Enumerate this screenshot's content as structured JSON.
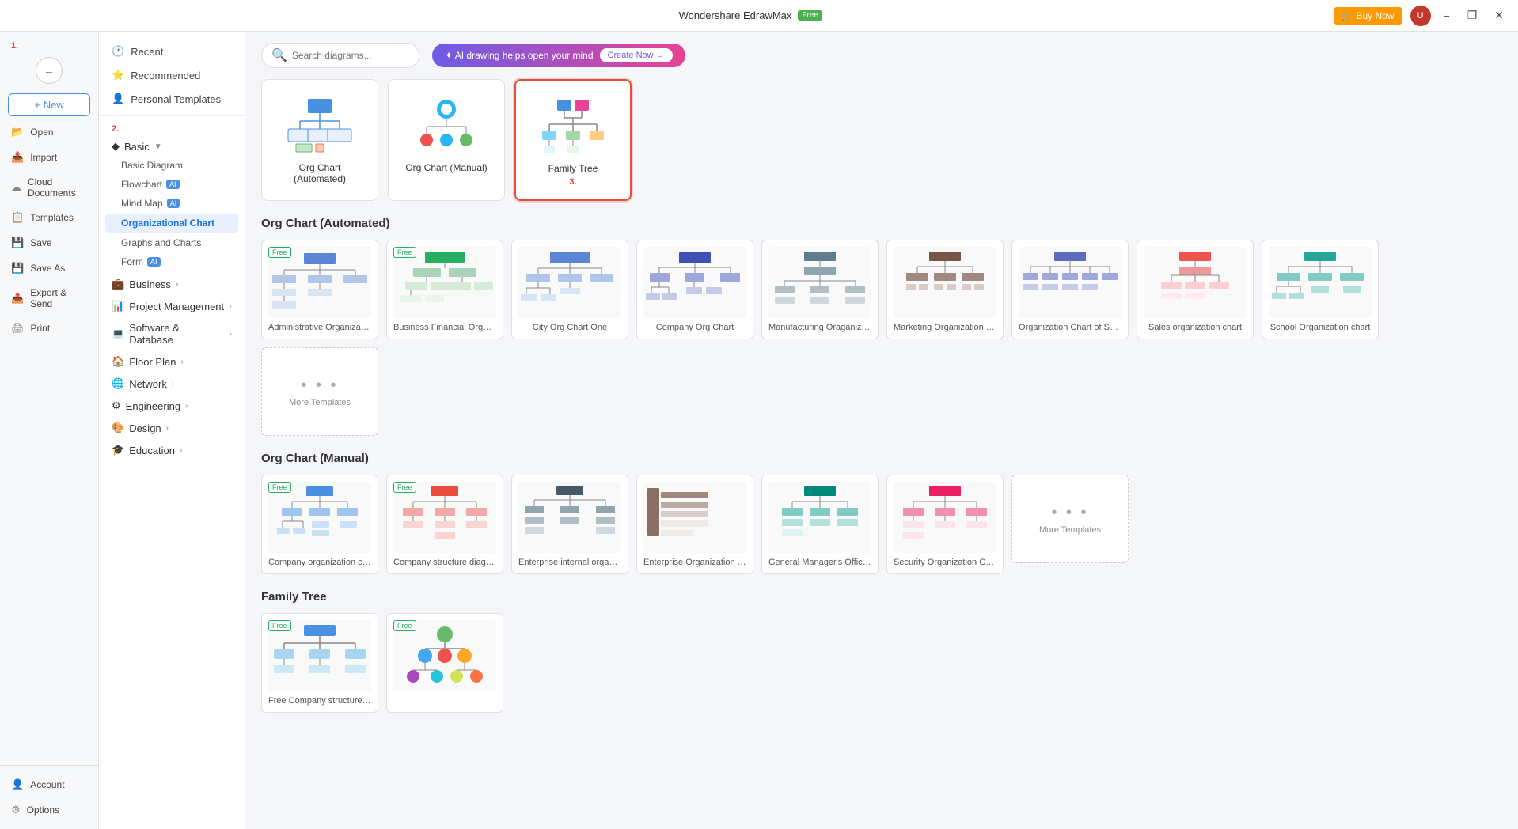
{
  "app": {
    "title": "Wondershare EdrawMax",
    "badge": "Free",
    "buy_now": "Buy Now"
  },
  "titlebar": {
    "win_minimize": "−",
    "win_restore": "❐",
    "win_close": "✕"
  },
  "sidebar": {
    "step1_label": "1.",
    "back_tooltip": "Back",
    "new_label": "New",
    "items": [
      {
        "id": "open",
        "icon": "📂",
        "label": "Open"
      },
      {
        "id": "import",
        "icon": "📥",
        "label": "Import"
      },
      {
        "id": "cloud",
        "icon": "☁",
        "label": "Cloud Documents"
      },
      {
        "id": "templates",
        "icon": "📋",
        "label": "Templates"
      },
      {
        "id": "save",
        "icon": "💾",
        "label": "Save"
      },
      {
        "id": "save-as",
        "icon": "💾",
        "label": "Save As"
      },
      {
        "id": "export",
        "icon": "📤",
        "label": "Export & Send"
      },
      {
        "id": "print",
        "icon": "🖨",
        "label": "Print"
      }
    ],
    "bottom_items": [
      {
        "id": "account",
        "icon": "👤",
        "label": "Account"
      },
      {
        "id": "options",
        "icon": "⚙",
        "label": "Options"
      }
    ]
  },
  "nav": {
    "step2_label": "2.",
    "recent_label": "Recent",
    "recommended_label": "Recommended",
    "personal_label": "Personal Templates",
    "sections": [
      {
        "id": "basic",
        "label": "Basic",
        "expanded": true,
        "subs": [
          {
            "id": "basic-diagram",
            "label": "Basic Diagram",
            "active": false
          },
          {
            "id": "flowchart",
            "label": "Flowchart",
            "ai": true,
            "active": false
          },
          {
            "id": "mind-map",
            "label": "Mind Map",
            "ai": true,
            "active": false
          },
          {
            "id": "org-chart",
            "label": "Organizational Chart",
            "active": true
          }
        ]
      },
      {
        "id": "graphs",
        "label": "Graphs and Charts",
        "subs": []
      },
      {
        "id": "form",
        "label": "Form",
        "ai": true,
        "subs": []
      },
      {
        "id": "business",
        "label": "Business",
        "subs": []
      },
      {
        "id": "project",
        "label": "Project Management",
        "subs": []
      },
      {
        "id": "software",
        "label": "Software & Database",
        "subs": []
      },
      {
        "id": "floor",
        "label": "Floor Plan",
        "subs": []
      },
      {
        "id": "network",
        "label": "Network",
        "subs": []
      },
      {
        "id": "engineering",
        "label": "Engineering",
        "subs": []
      },
      {
        "id": "design",
        "label": "Design",
        "subs": []
      },
      {
        "id": "education",
        "label": "Education",
        "subs": []
      }
    ]
  },
  "search": {
    "placeholder": "Search diagrams..."
  },
  "ai_bar": {
    "text": "✦ AI drawing helps open your mind",
    "button": "Create Now →"
  },
  "template_types": [
    {
      "id": "automated",
      "label": "Org Chart (Automated)",
      "selected": false
    },
    {
      "id": "manual",
      "label": "Org Chart (Manual)",
      "selected": false
    },
    {
      "id": "family-tree",
      "label": "Family Tree",
      "selected": true
    }
  ],
  "step3_label": "3.",
  "sections": [
    {
      "id": "automated",
      "title": "Org Chart (Automated)",
      "templates": [
        {
          "id": "admin-org",
          "name": "Administrative Organizatio...",
          "free": true
        },
        {
          "id": "biz-fin-org",
          "name": "Business Financial Organiz...",
          "free": true
        },
        {
          "id": "city-org",
          "name": "City Org Chart One",
          "free": false
        },
        {
          "id": "company-org",
          "name": "Company Org Chart",
          "free": false
        },
        {
          "id": "manufacturing",
          "name": "Manufacturing Oraganizati...",
          "free": false
        },
        {
          "id": "marketing",
          "name": "Marketing Organization C...",
          "free": false
        },
        {
          "id": "sale-org",
          "name": "Organization Chart of Sale...",
          "free": false
        }
      ],
      "row2": [
        {
          "id": "sales-org",
          "name": "Sales organization chart",
          "free": false
        },
        {
          "id": "school-org",
          "name": "School Organization chart",
          "free": false
        }
      ],
      "more": true
    },
    {
      "id": "manual",
      "title": "Org Chart (Manual)",
      "templates": [
        {
          "id": "company-org2",
          "name": "Company organization chart",
          "free": true
        },
        {
          "id": "company-struct",
          "name": "Company structure diagram",
          "free": true
        },
        {
          "id": "enterprise-int",
          "name": "Enterprise internal organiz...",
          "free": false
        },
        {
          "id": "enterprise-org",
          "name": "Enterprise Organization Ch...",
          "free": false
        },
        {
          "id": "gm-office",
          "name": "General Manager's Office ...",
          "free": false
        },
        {
          "id": "security-org",
          "name": "Security Organization Chart",
          "free": false
        }
      ],
      "more": true
    },
    {
      "id": "family-tree",
      "title": "Family Tree",
      "templates": [
        {
          "id": "ft1",
          "name": "Free Company structure diagram",
          "free": true
        },
        {
          "id": "ft2",
          "name": "",
          "free": true
        }
      ],
      "more": false
    }
  ]
}
